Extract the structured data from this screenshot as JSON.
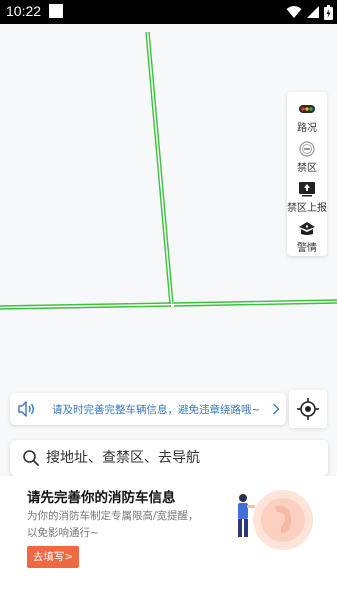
{
  "status_bar": {
    "time": "10:22"
  },
  "map_tools": [
    {
      "icon": "traffic-light-icon",
      "label": "路况"
    },
    {
      "icon": "no-entry-icon",
      "label": "禁区"
    },
    {
      "icon": "upload-icon",
      "label": "禁区上报"
    },
    {
      "icon": "police-cap-icon",
      "label": "警情"
    }
  ],
  "notice": {
    "icon": "speaker-icon",
    "text": "请及时完善完整车辆信息，避免违章绕路哦~"
  },
  "search": {
    "placeholder": "搜地址、查禁区、去导航"
  },
  "promo": {
    "title": "请先完善你的消防车信息",
    "description": "为你的消防车制定专属限高/宽提醒，以免影响通行~",
    "button_label": "去填写>"
  },
  "colors": {
    "road_green": "#3cc23c",
    "notice_blue": "#3a78c2",
    "accent_orange": "#f0683f"
  }
}
